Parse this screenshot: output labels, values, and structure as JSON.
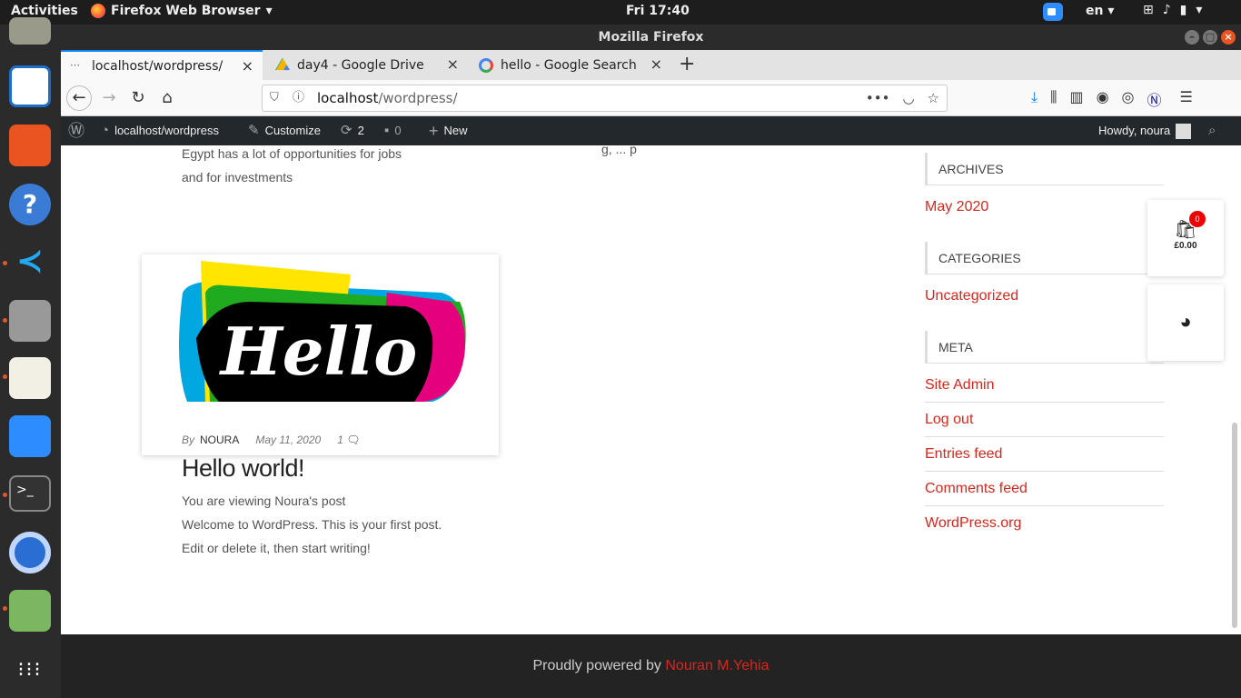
{
  "topbar": {
    "activities": "Activities",
    "app_name": "Firefox Web Browser",
    "clock": "Fri 17:40",
    "language": "en"
  },
  "window": {
    "title": "Mozilla Firefox"
  },
  "tabs": [
    {
      "label": "localhost/wordpress/",
      "active": true
    },
    {
      "label": "day4 - Google Drive",
      "active": false
    },
    {
      "label": "hello - Google Search",
      "active": false
    }
  ],
  "urlbar": {
    "host": "localhost",
    "path": "/wordpress/"
  },
  "wp_admin_bar": {
    "site": "localhost/wordpress",
    "customize": "Customize",
    "updates": "2",
    "comments": "0",
    "new": "New",
    "howdy": "Howdy, noura"
  },
  "page": {
    "cut_text": "Egypt has a lot of opportunities for jobs and for investments",
    "post": {
      "by": "By",
      "author": "NOURA",
      "date": "May 11, 2020",
      "comments": "1",
      "title": "Hello world!",
      "excerpt_line1": "You are viewing Noura's post",
      "excerpt_line2": "Welcome to WordPress. This is your first post. Edit or delete it, then start writing!",
      "image_text": "Hello"
    },
    "sidebar": {
      "archives_title": "ARCHIVES",
      "archives_link": "May 2020",
      "categories_title": "CATEGORIES",
      "categories_link": "Uncategorized",
      "meta_title": "META",
      "meta_links": [
        "Site Admin",
        "Log out",
        "Entries feed",
        "Comments feed",
        "WordPress.org"
      ]
    },
    "cart": {
      "count": "0",
      "total": "£0.00"
    }
  },
  "footer": {
    "text": "Proudly powered by",
    "credit": "Nouran M.Yehia"
  },
  "colors": {
    "accent": "#d9261c",
    "wp_bar": "#23282d",
    "footer": "#232323"
  }
}
